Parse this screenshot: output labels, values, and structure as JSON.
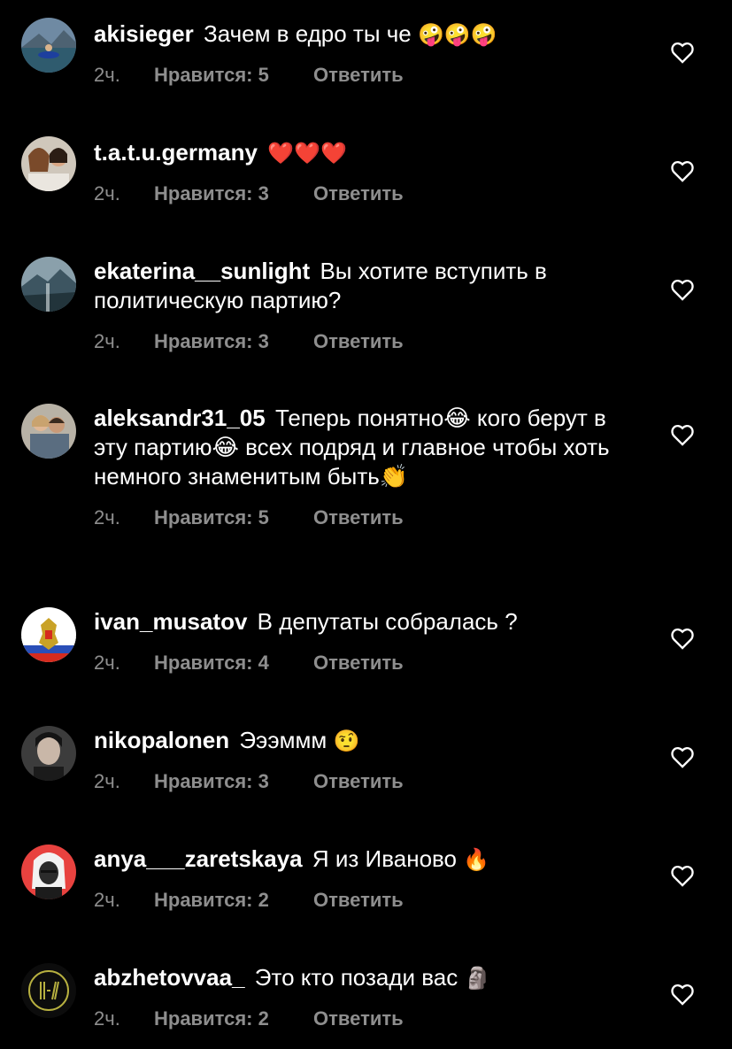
{
  "comments": [
    {
      "username": "akisieger",
      "text": "Зачем в едро ты че",
      "emoji": "🤪🤪🤪",
      "time": "2ч.",
      "likes": "Нравится: 5",
      "reply": "Ответить",
      "avatar": "lake-kayak"
    },
    {
      "username": "t.a.t.u.germany",
      "text": "",
      "emoji": "❤️❤️❤️",
      "time": "2ч.",
      "likes": "Нравится: 3",
      "reply": "Ответить",
      "avatar": "two-women"
    },
    {
      "username": "ekaterina__sunlight",
      "text": "Вы хотите вступить в политическую партию?",
      "emoji": "",
      "time": "2ч.",
      "likes": "Нравится: 3",
      "reply": "Ответить",
      "avatar": "mountain-landscape"
    },
    {
      "username": "aleksandr31_05",
      "text": "Теперь понятно😂 кого берут в эту партию😂 всех подряд и главное чтобы хоть немного знаменитым быть👏",
      "emoji": "",
      "time": "2ч.",
      "likes": "Нравится: 5",
      "reply": "Ответить",
      "avatar": "couple"
    },
    {
      "username": "ivan_musatov",
      "text": "В депутаты собралась ?",
      "emoji": "",
      "time": "2ч.",
      "likes": "Нравится: 4",
      "reply": "Ответить",
      "avatar": "russian-coat-of-arms"
    },
    {
      "username": "nikopalonen",
      "text": "Эээммм",
      "emoji": "🤨",
      "time": "2ч.",
      "likes": "Нравится: 3",
      "reply": "Ответить",
      "avatar": "portrait-dark"
    },
    {
      "username": "anya___zaretskaya",
      "text": "Я из Иваново",
      "emoji": "🔥",
      "time": "2ч.",
      "likes": "Нравится: 2",
      "reply": "Ответить",
      "avatar": "cartoon-girl-red"
    },
    {
      "username": "abzhetovvaa_",
      "text": "Это кто позади вас",
      "emoji": "🗿",
      "time": "2ч.",
      "likes": "Нравится: 2",
      "reply": "Ответить",
      "avatar": "logo-lines"
    }
  ],
  "colors": {
    "background": "#000000",
    "text": "#ffffff",
    "meta": "#8e8e8e",
    "heart-stroke": "#ffffff"
  },
  "icons": {
    "like": "heart-outline-icon"
  }
}
